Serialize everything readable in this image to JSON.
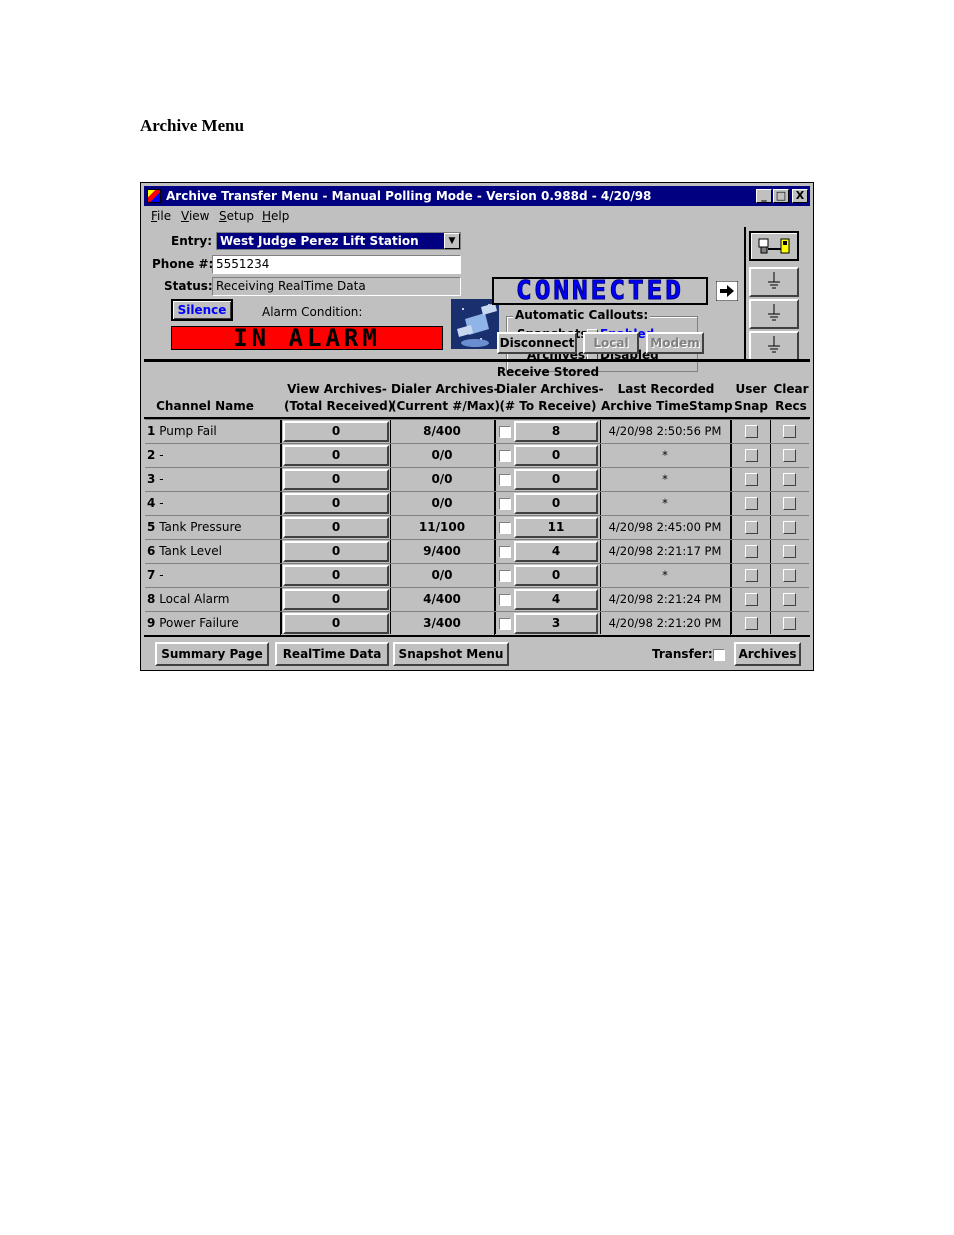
{
  "doc": {
    "heading": "Archive Menu"
  },
  "window": {
    "title": "Archive Transfer Menu - Manual Polling Mode - Version 0.988d - 4/20/98",
    "controls": {
      "minimize": "_",
      "maximize": "□",
      "close": "X"
    }
  },
  "menu": [
    "File",
    "View",
    "Setup",
    "Help"
  ],
  "entry": {
    "label": "Entry:",
    "value": "West Judge Perez Lift Station"
  },
  "phone": {
    "label": "Phone #:",
    "value": "5551234"
  },
  "status": {
    "label": "Status:",
    "value": "Receiving RealTime Data"
  },
  "silence_button": "Silence",
  "alarm": {
    "label": "Alarm Condition:",
    "display": "IN ALARM"
  },
  "connection": {
    "display": "CONNECTED"
  },
  "callouts": {
    "title": "Automatic Callouts:",
    "snapshots_label": "Snapshots:",
    "snapshots_value": "Enabled",
    "archives_label": "Archives:",
    "archives_value": "Disabled"
  },
  "buttons": {
    "disconnect": "Disconnect",
    "local": "Local",
    "modem": "Modem"
  },
  "columns": {
    "channel": "Channel Name",
    "view_l1": "View Archives-",
    "view_l2": "(Total Received)",
    "dialer_l1": "Dialer Archives-",
    "dialer_l2": "(Current #/Max)",
    "recv_l0": "Receive Stored",
    "recv_l1": "Dialer Archives-",
    "recv_l2": "(# To Receive)",
    "last_l1": "Last Recorded",
    "last_l2": "Archive TimeStamp",
    "user_l1": "User",
    "user_l2": "Snap",
    "clear_l1": "Clear",
    "clear_l2": "Recs"
  },
  "rows": [
    {
      "num": "1",
      "name": "Pump Fail",
      "view": "0",
      "dialer": "8/400",
      "receive": "8",
      "timestamp": "4/20/98 2:50:56 PM"
    },
    {
      "num": "2",
      "name": "-",
      "view": "0",
      "dialer": "0/0",
      "receive": "0",
      "timestamp": "*"
    },
    {
      "num": "3",
      "name": "-",
      "view": "0",
      "dialer": "0/0",
      "receive": "0",
      "timestamp": "*"
    },
    {
      "num": "4",
      "name": "-",
      "view": "0",
      "dialer": "0/0",
      "receive": "0",
      "timestamp": "*"
    },
    {
      "num": "5",
      "name": "Tank Pressure",
      "view": "0",
      "dialer": "11/100",
      "receive": "11",
      "timestamp": "4/20/98 2:45:00 PM"
    },
    {
      "num": "6",
      "name": "Tank Level",
      "view": "0",
      "dialer": "9/400",
      "receive": "4",
      "timestamp": "4/20/98 2:21:17 PM"
    },
    {
      "num": "7",
      "name": "-",
      "view": "0",
      "dialer": "0/0",
      "receive": "0",
      "timestamp": "*"
    },
    {
      "num": "8",
      "name": "Local Alarm",
      "view": "0",
      "dialer": "4/400",
      "receive": "4",
      "timestamp": "4/20/98 2:21:24 PM"
    },
    {
      "num": "9",
      "name": "Power Failure",
      "view": "0",
      "dialer": "3/400",
      "receive": "3",
      "timestamp": "4/20/98 2:21:20 PM"
    }
  ],
  "footer": {
    "summary": "Summary Page",
    "realtime": "RealTime Data",
    "snapshot": "Snapshot Menu",
    "transfer_label": "Transfer:",
    "archives": "Archives"
  },
  "colors": {
    "title_bar": "#000080",
    "alarm_bg": "#ff0000",
    "connected_text": "#0000ff",
    "enabled_text": "#0000ff",
    "face": "#c0c0c0"
  }
}
